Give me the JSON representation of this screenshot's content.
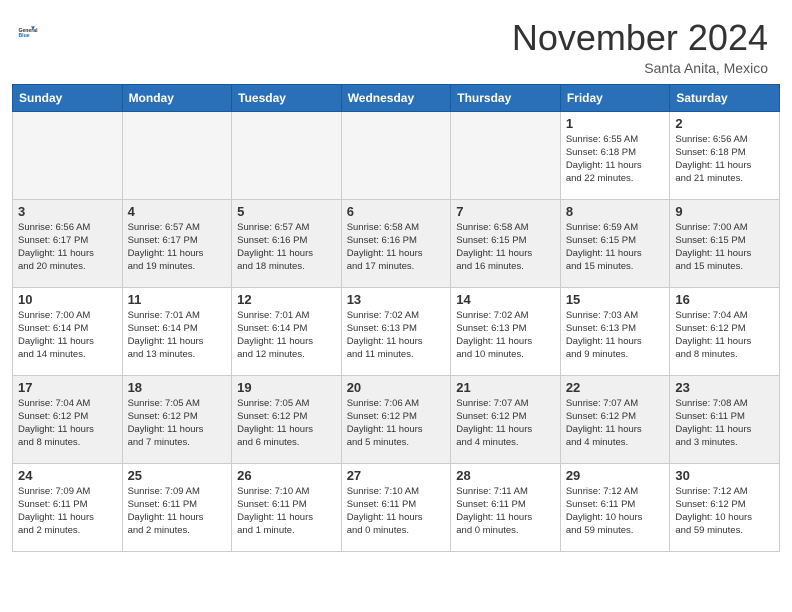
{
  "header": {
    "logo": {
      "general": "General",
      "blue": "Blue"
    },
    "month_title": "November 2024",
    "location": "Santa Anita, Mexico"
  },
  "weekdays": [
    "Sunday",
    "Monday",
    "Tuesday",
    "Wednesday",
    "Thursday",
    "Friday",
    "Saturday"
  ],
  "weeks": [
    [
      {
        "day": "",
        "empty": true
      },
      {
        "day": "",
        "empty": true
      },
      {
        "day": "",
        "empty": true
      },
      {
        "day": "",
        "empty": true
      },
      {
        "day": "",
        "empty": true
      },
      {
        "day": "1",
        "info": "Sunrise: 6:55 AM\nSunset: 6:18 PM\nDaylight: 11 hours\nand 22 minutes."
      },
      {
        "day": "2",
        "info": "Sunrise: 6:56 AM\nSunset: 6:18 PM\nDaylight: 11 hours\nand 21 minutes."
      }
    ],
    [
      {
        "day": "3",
        "info": "Sunrise: 6:56 AM\nSunset: 6:17 PM\nDaylight: 11 hours\nand 20 minutes."
      },
      {
        "day": "4",
        "info": "Sunrise: 6:57 AM\nSunset: 6:17 PM\nDaylight: 11 hours\nand 19 minutes."
      },
      {
        "day": "5",
        "info": "Sunrise: 6:57 AM\nSunset: 6:16 PM\nDaylight: 11 hours\nand 18 minutes."
      },
      {
        "day": "6",
        "info": "Sunrise: 6:58 AM\nSunset: 6:16 PM\nDaylight: 11 hours\nand 17 minutes."
      },
      {
        "day": "7",
        "info": "Sunrise: 6:58 AM\nSunset: 6:15 PM\nDaylight: 11 hours\nand 16 minutes."
      },
      {
        "day": "8",
        "info": "Sunrise: 6:59 AM\nSunset: 6:15 PM\nDaylight: 11 hours\nand 15 minutes."
      },
      {
        "day": "9",
        "info": "Sunrise: 7:00 AM\nSunset: 6:15 PM\nDaylight: 11 hours\nand 15 minutes."
      }
    ],
    [
      {
        "day": "10",
        "info": "Sunrise: 7:00 AM\nSunset: 6:14 PM\nDaylight: 11 hours\nand 14 minutes."
      },
      {
        "day": "11",
        "info": "Sunrise: 7:01 AM\nSunset: 6:14 PM\nDaylight: 11 hours\nand 13 minutes."
      },
      {
        "day": "12",
        "info": "Sunrise: 7:01 AM\nSunset: 6:14 PM\nDaylight: 11 hours\nand 12 minutes."
      },
      {
        "day": "13",
        "info": "Sunrise: 7:02 AM\nSunset: 6:13 PM\nDaylight: 11 hours\nand 11 minutes."
      },
      {
        "day": "14",
        "info": "Sunrise: 7:02 AM\nSunset: 6:13 PM\nDaylight: 11 hours\nand 10 minutes."
      },
      {
        "day": "15",
        "info": "Sunrise: 7:03 AM\nSunset: 6:13 PM\nDaylight: 11 hours\nand 9 minutes."
      },
      {
        "day": "16",
        "info": "Sunrise: 7:04 AM\nSunset: 6:12 PM\nDaylight: 11 hours\nand 8 minutes."
      }
    ],
    [
      {
        "day": "17",
        "info": "Sunrise: 7:04 AM\nSunset: 6:12 PM\nDaylight: 11 hours\nand 8 minutes."
      },
      {
        "day": "18",
        "info": "Sunrise: 7:05 AM\nSunset: 6:12 PM\nDaylight: 11 hours\nand 7 minutes."
      },
      {
        "day": "19",
        "info": "Sunrise: 7:05 AM\nSunset: 6:12 PM\nDaylight: 11 hours\nand 6 minutes."
      },
      {
        "day": "20",
        "info": "Sunrise: 7:06 AM\nSunset: 6:12 PM\nDaylight: 11 hours\nand 5 minutes."
      },
      {
        "day": "21",
        "info": "Sunrise: 7:07 AM\nSunset: 6:12 PM\nDaylight: 11 hours\nand 4 minutes."
      },
      {
        "day": "22",
        "info": "Sunrise: 7:07 AM\nSunset: 6:12 PM\nDaylight: 11 hours\nand 4 minutes."
      },
      {
        "day": "23",
        "info": "Sunrise: 7:08 AM\nSunset: 6:11 PM\nDaylight: 11 hours\nand 3 minutes."
      }
    ],
    [
      {
        "day": "24",
        "info": "Sunrise: 7:09 AM\nSunset: 6:11 PM\nDaylight: 11 hours\nand 2 minutes."
      },
      {
        "day": "25",
        "info": "Sunrise: 7:09 AM\nSunset: 6:11 PM\nDaylight: 11 hours\nand 2 minutes."
      },
      {
        "day": "26",
        "info": "Sunrise: 7:10 AM\nSunset: 6:11 PM\nDaylight: 11 hours\nand 1 minute."
      },
      {
        "day": "27",
        "info": "Sunrise: 7:10 AM\nSunset: 6:11 PM\nDaylight: 11 hours\nand 0 minutes."
      },
      {
        "day": "28",
        "info": "Sunrise: 7:11 AM\nSunset: 6:11 PM\nDaylight: 11 hours\nand 0 minutes."
      },
      {
        "day": "29",
        "info": "Sunrise: 7:12 AM\nSunset: 6:11 PM\nDaylight: 10 hours\nand 59 minutes."
      },
      {
        "day": "30",
        "info": "Sunrise: 7:12 AM\nSunset: 6:12 PM\nDaylight: 10 hours\nand 59 minutes."
      }
    ]
  ]
}
